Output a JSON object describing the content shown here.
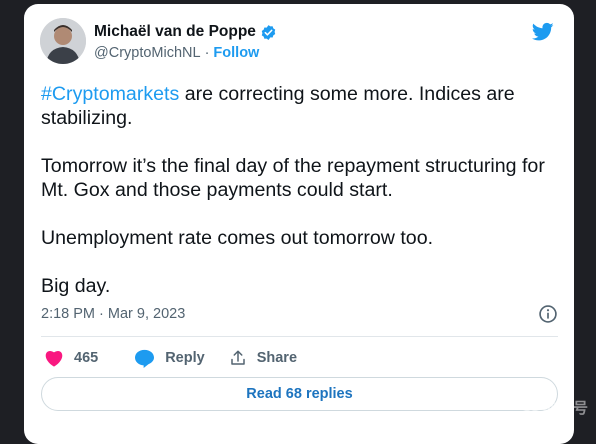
{
  "tweet": {
    "author_name": "Michaël van de Poppe",
    "handle": "@CryptoMichNL",
    "separator": "·",
    "follow_label": "Follow",
    "hashtag": "#Cryptomarkets",
    "line1_rest": " are correcting some more. Indices are stabilizing.",
    "paragraph2": "Tomorrow it’s the final day of the repayment structuring for Mt. Gox and those payments could start.",
    "paragraph3": "Unemployment rate comes out tomorrow too.",
    "paragraph4": "Big day.",
    "timestamp": "2:18 PM · Mar 9, 2023",
    "likes_count": "465",
    "reply_label": "Reply",
    "share_label": "Share",
    "read_replies_label": "Read 68 replies"
  },
  "watermark": "非小号",
  "icons": [
    "twitter-bird-icon",
    "verified-badge-icon",
    "info-icon",
    "heart-icon",
    "reply-bubble-icon",
    "share-icon"
  ],
  "colors": {
    "accent": "#1d9bf0",
    "like": "#f91880",
    "background": "#1e1f24"
  }
}
